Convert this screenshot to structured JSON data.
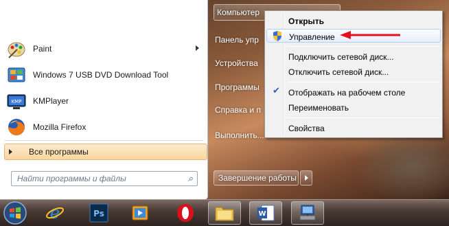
{
  "start_menu": {
    "programs": [
      {
        "label": "Paint",
        "icon": "paint-palette-icon",
        "has_submenu": true
      },
      {
        "label": "Windows 7 USB DVD Download Tool",
        "icon": "usb-dvd-tool-icon",
        "has_submenu": false
      },
      {
        "label": "KMPlayer",
        "icon": "kmplayer-icon",
        "has_submenu": false
      },
      {
        "label": "Mozilla Firefox",
        "icon": "firefox-icon",
        "has_submenu": false
      }
    ],
    "all_programs": "Все программы",
    "search_placeholder": "Найти программы и файлы",
    "right_items": [
      "Компьютер",
      "Панель упр",
      "Устройства",
      "Программы",
      "Справка и п",
      "Выполнить..."
    ],
    "shutdown": "Завершение работы"
  },
  "context_menu": {
    "items": [
      {
        "label": "Открыть",
        "bold": true
      },
      {
        "label": "Управление",
        "icon": "uac-shield-icon",
        "highlighted": true
      },
      {
        "label": "Подключить сетевой диск..."
      },
      {
        "label": "Отключить сетевой диск..."
      },
      {
        "label": "Отображать на рабочем столе",
        "checked": true
      },
      {
        "label": "Переименовать"
      },
      {
        "label": "Свойства"
      }
    ]
  },
  "taskbar": {
    "buttons": [
      "internet-explorer-icon",
      "photoshop-icon",
      "media-player-icon",
      "opera-icon",
      "explorer-folder-icon",
      "word-icon",
      "network-computer-icon"
    ]
  },
  "colors": {
    "highlight_border": "#aecff7",
    "arrow_red": "#e0141c",
    "check_blue": "#2a5ac8"
  }
}
